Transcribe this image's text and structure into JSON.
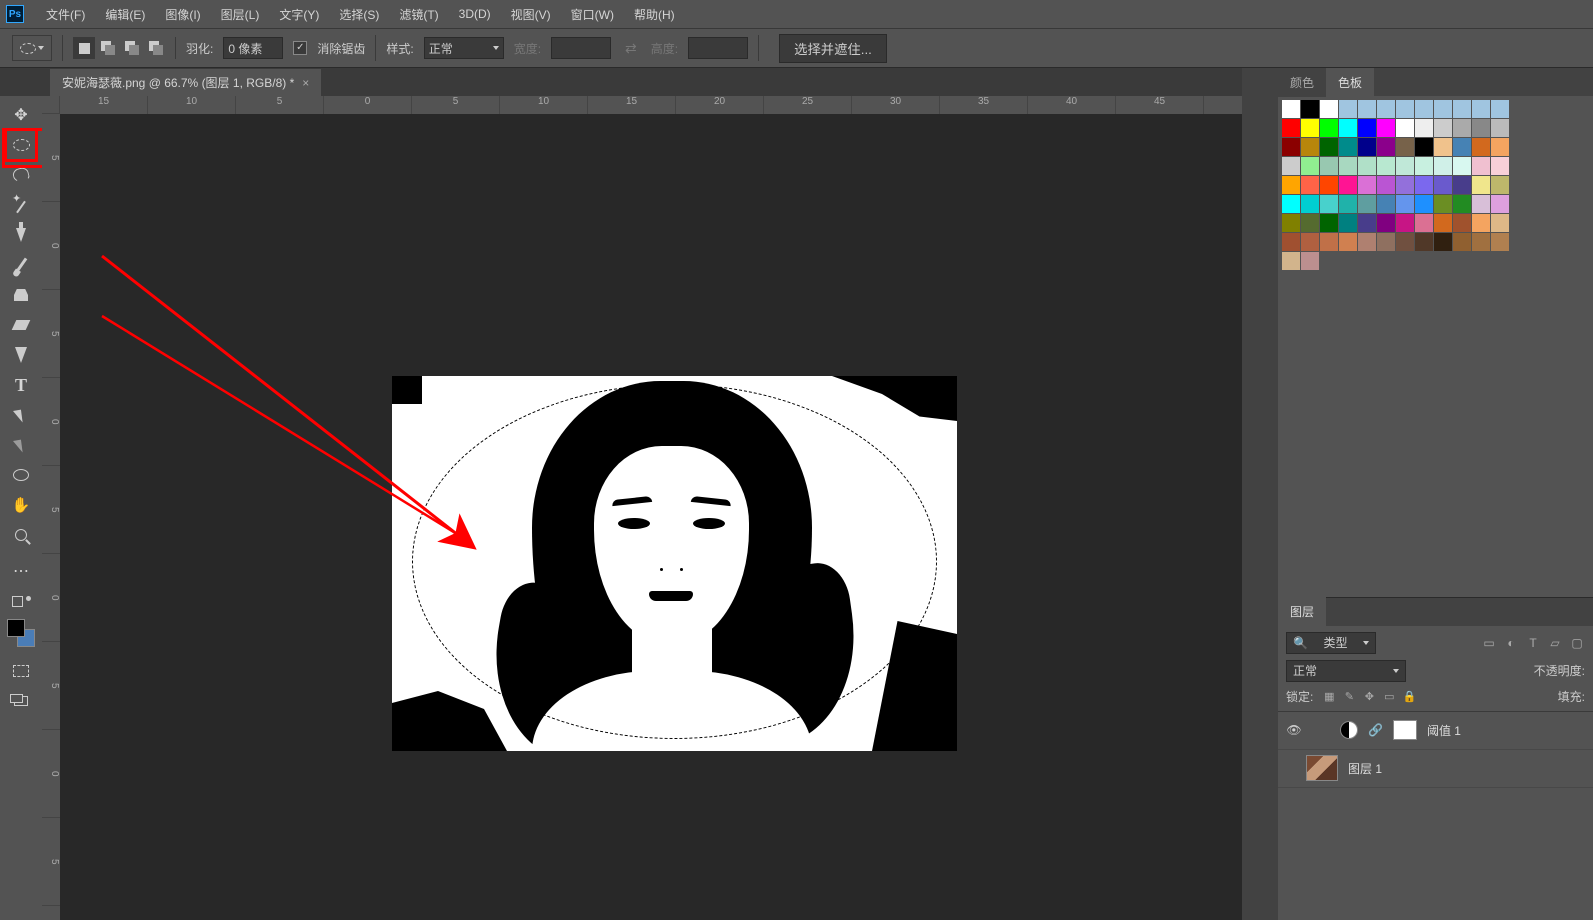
{
  "menubar": {
    "items": [
      "文件(F)",
      "编辑(E)",
      "图像(I)",
      "图层(L)",
      "文字(Y)",
      "选择(S)",
      "滤镜(T)",
      "3D(D)",
      "视图(V)",
      "窗口(W)",
      "帮助(H)"
    ]
  },
  "options": {
    "feather_label": "羽化:",
    "feather_value": "0 像素",
    "antialias_label": "消除锯齿",
    "style_label": "样式:",
    "style_value": "正常",
    "width_label": "宽度:",
    "width_value": "",
    "height_label": "高度:",
    "height_value": "",
    "select_mask_btn": "选择并遮住..."
  },
  "document": {
    "tab_title": "安妮海瑟薇.png @ 66.7% (图层 1, RGB/8) *"
  },
  "ruler_h": [
    "15",
    "10",
    "5",
    "0",
    "5",
    "10",
    "15",
    "20",
    "25",
    "30",
    "35",
    "40",
    "45"
  ],
  "ruler_v": [
    "5",
    "0",
    "5",
    "0",
    "5",
    "0",
    "5",
    "0",
    "5"
  ],
  "panels": {
    "color_tab": "颜色",
    "swatches_tab": "色板",
    "layers_tab": "图层",
    "kind_label": "类型",
    "blend_mode": "正常",
    "opacity_label": "不透明度:",
    "lock_label": "锁定:",
    "fill_label": "填充:",
    "layer_threshold": "阈值 1",
    "layer_1": "图层 1"
  },
  "swatch_rows": [
    [
      "#ffffff",
      "#000000",
      "#ffffff",
      "#a0c5e0",
      "#a0c5e0",
      "#a0c5e0",
      "#a0c5e0",
      "#a0c5e0",
      "#a0c5e0",
      "#a0c5e0",
      "#a0c5e0",
      "#a0c5e0"
    ],
    [
      "#ff0000",
      "#ffff00",
      "#00ff00",
      "#00ffff",
      "#0000ff",
      "#ff00ff",
      "#ffffff",
      "#eeeeee",
      "#cccccc",
      "#aaaaaa",
      "#888888",
      "#bbbbbb"
    ],
    [
      "#8b0000",
      "#b8860b",
      "#006400",
      "#008b8b",
      "#00008b",
      "#8b008b",
      "#77624a",
      "#000000",
      "#f0c28c",
      "#4682b4",
      "#d2691e",
      "#f4a460"
    ],
    [
      "#cccccc",
      "#90ee90",
      "#98c8b0",
      "#a8d8c0",
      "#b0e0c8",
      "#b8e8d0",
      "#c0e8d8",
      "#c8f0e0",
      "#d0f0e8",
      "#d8f8f0",
      "#f0c0d0",
      "#f8d0d8"
    ],
    [
      "#ffa500",
      "#ff6347",
      "#ff4500",
      "#ff1493",
      "#da70d6",
      "#ba55d3",
      "#9370db",
      "#7b68ee",
      "#6a5acd",
      "#483d8b",
      "#f0e68c",
      "#bdb76b"
    ],
    [
      "#00ffff",
      "#00ced1",
      "#48d1cc",
      "#20b2aa",
      "#5f9ea0",
      "#4682b4",
      "#6495ed",
      "#1e90ff",
      "#6b8e23",
      "#228b22",
      "#d8bfd8",
      "#dda0dd"
    ],
    [
      "#808000",
      "#556b2f",
      "#006400",
      "#008080",
      "#483d8b",
      "#800080",
      "#c71585",
      "#db7093",
      "#d2691e",
      "#a0522d",
      "#f4a460",
      "#deb887"
    ],
    [
      "#a05030",
      "#b06040",
      "#c07048",
      "#d08050",
      "#af8070",
      "#8f7060",
      "#705040",
      "#503828",
      "#302010",
      "#906030",
      "#a07040",
      "#b08050"
    ],
    [
      "#d2b48c",
      "#bc8f8f"
    ]
  ]
}
